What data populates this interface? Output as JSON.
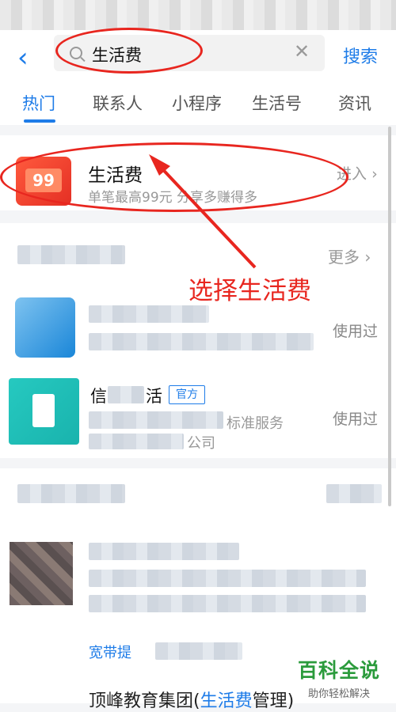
{
  "header": {
    "back_icon": "chevron-left-icon",
    "search_query": "生活费",
    "clear_icon": "close-icon",
    "search_button": "搜索"
  },
  "tabs": [
    {
      "label": "热门",
      "active": true
    },
    {
      "label": "联系人",
      "active": false
    },
    {
      "label": "小程序",
      "active": false
    },
    {
      "label": "生活号",
      "active": false
    },
    {
      "label": "资讯",
      "active": false
    }
  ],
  "top_result": {
    "icon": "red-envelope-icon",
    "icon_badge": "99",
    "title": "生活费",
    "subtitle": "单笔最高99元  分享多赚得多",
    "action": "进入",
    "action_icon": "chevron-right-icon"
  },
  "section": {
    "more": "更多",
    "more_icon": "chevron-right-icon",
    "items": [
      {
        "status": "使用过"
      },
      {
        "name_part_1": "信",
        "name_part_2": "活",
        "badge": "官方",
        "desc": "标准服务",
        "company": "公司",
        "status": "使用过"
      }
    ]
  },
  "section2": {
    "link_text": "宽带提",
    "bottom_title_prefix": "顶峰教育集团(",
    "bottom_title_highlight": "生活费",
    "bottom_title_suffix": "管理)"
  },
  "annotation": {
    "text": "选择生活费",
    "color": "#e8261f"
  },
  "watermark": {
    "main": "百科全说",
    "sub": "助你轻松解决"
  },
  "colors": {
    "accent": "#1e7ce8",
    "watermark": "#2b9b3c"
  }
}
